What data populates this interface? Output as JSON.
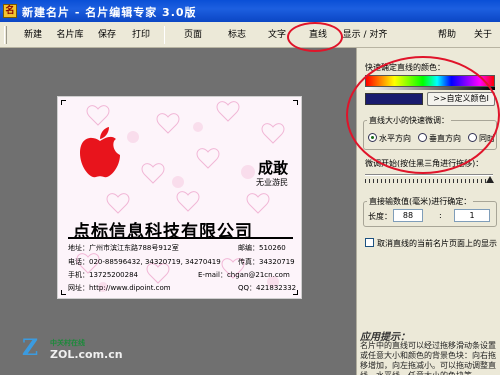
{
  "window": {
    "title": "新建名片 - 名片编辑专家 3.0版",
    "app_icon_glyph": "名"
  },
  "toolbar": {
    "items": [
      {
        "label": "新建"
      },
      {
        "label": "名片库"
      },
      {
        "label": "保存"
      },
      {
        "label": "打印"
      },
      {
        "label": "页面"
      },
      {
        "label": "标志"
      },
      {
        "label": "文字"
      },
      {
        "label": "直线"
      },
      {
        "label": "显示 / 对齐"
      },
      {
        "label": "帮助"
      },
      {
        "label": "关于"
      }
    ]
  },
  "card": {
    "name": "成敢",
    "subtitle": "无业游民",
    "company": "点标信息科技有限公司",
    "address_label": "地址：广州市滨江东路788号912室",
    "postcode": "邮编：510260",
    "phone": "电话：020-88596432, 34320719, 34270419",
    "fax": "传真：34320719",
    "mobile": "手机：13725200284",
    "email": "E-mail：chgan@21cn.com",
    "website": "网址：http://www.dipoint.com",
    "qq": "QQ：421832332"
  },
  "watermark": {
    "logo": "Z",
    "top": "中关村在线",
    "bottom": "ZOL.com.cn"
  },
  "panel": {
    "color_label": "快速确定直线的颜色：",
    "custom_color_button": ">>自定义颜色I",
    "size_group_title": "直线大小的快速微调：",
    "size_options": [
      {
        "label": "水平方向",
        "selected": true
      },
      {
        "label": "垂直方向",
        "selected": false
      },
      {
        "label": "同时",
        "selected": false
      }
    ],
    "slider_label": "微调开始(按住黑三角进行拖移)：",
    "numeric_group_title": "直接输数值(毫米)进行确定：",
    "length_label": "长度：",
    "length_value": "88",
    "colon": ":",
    "second_value": "1",
    "checkbox_label": "取消直线的当前名片页面上的显示",
    "checkbox_checked": false,
    "hint_title": "应用提示：",
    "hint_body": "名片中的直线可以经过拖移滑动条设置或任意大小和颜色的背景色块：向右拖移增加，向左拖减小。可以拖动调整直线，水平线，任意大小的色块等。"
  },
  "colors": {
    "selected_line_color": "#1a1b6e",
    "apple_red": "#e8141c",
    "annotation_red": "#e0142a"
  }
}
